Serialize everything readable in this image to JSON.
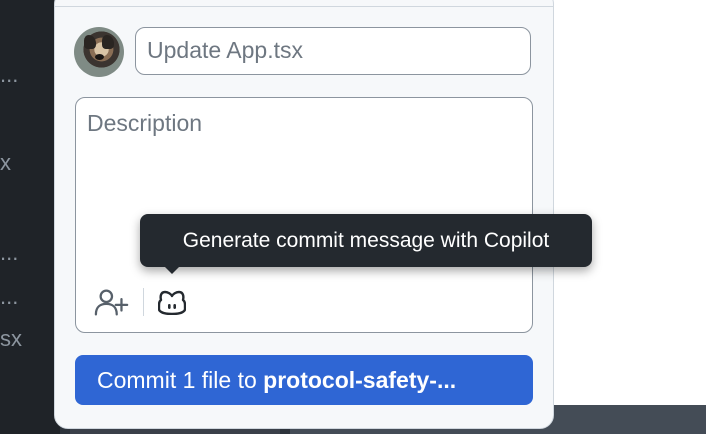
{
  "background": {
    "left_fragments": [
      "...",
      "x",
      "...",
      "...",
      "sx"
    ]
  },
  "commit_panel": {
    "summary_placeholder": "Update App.tsx",
    "description_placeholder": "Description",
    "commit_button": {
      "prefix": "Commit 1 file to ",
      "branch": "protocol-safety-..."
    },
    "tooltip": "Generate commit message with Copilot",
    "icons": [
      "add-coauthor-icon",
      "copilot-icon"
    ]
  },
  "colors": {
    "accent": "#2f66d4",
    "tooltip_bg": "#24292f"
  }
}
